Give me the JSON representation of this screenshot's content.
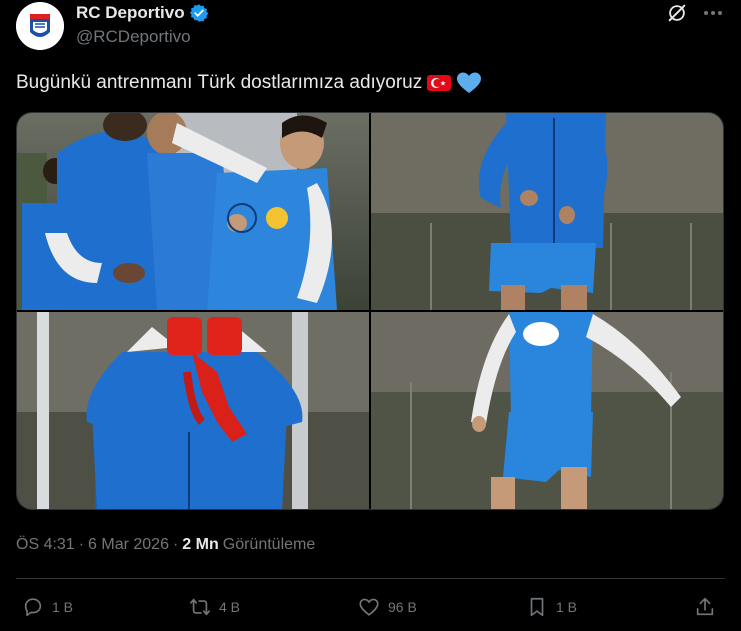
{
  "author": {
    "name": "RC Deportivo",
    "handle": "@RCDeportivo"
  },
  "tweet": {
    "text": "Bugünkü antrenmanı Türk dostlarımıza adıyoruz"
  },
  "meta": {
    "time": "ÖS 4:31",
    "separator": "·",
    "date": "6 Mar 2026",
    "views_count": "2 Mn",
    "views_label": "Görüntüleme"
  },
  "actions": {
    "reply_count": "1 B",
    "retweet_count": "4 B",
    "like_count": "96 B",
    "bookmark_count": "1 B"
  },
  "colors": {
    "background": "#000000",
    "text_primary": "#e7e9ea",
    "text_secondary": "#71767b",
    "verified": "#1d9bf0",
    "divider": "#2f3336",
    "kit_blue": "#1f6fcf"
  },
  "icons": [
    "verified-badge-icon",
    "grok-icon",
    "more-icon",
    "turkey-flag-icon",
    "blue-heart-icon",
    "reply-icon",
    "retweet-icon",
    "like-icon",
    "bookmark-icon",
    "share-icon"
  ]
}
